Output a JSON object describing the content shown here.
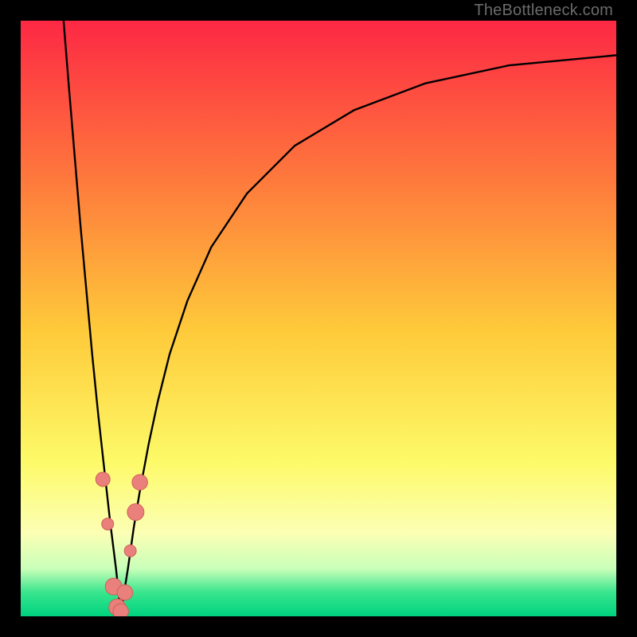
{
  "watermark": "TheBottleneck.com",
  "colors": {
    "grad_top": "#fd2844",
    "grad_mid1": "#fe7d3c",
    "grad_mid2": "#feca3a",
    "grad_mid3": "#fdfa68",
    "grad_mid4": "#fcffb4",
    "grad_bottom1": "#c9ffb9",
    "grad_bottom2": "#38e58d",
    "grad_bottom3": "#00d27f",
    "curve_stroke": "#000000",
    "marker_fill": "#e9807b",
    "marker_stroke": "#d35e59"
  },
  "chart_data": {
    "type": "line",
    "title": "",
    "xlabel": "",
    "ylabel": "",
    "xlim": [
      0,
      100
    ],
    "ylim": [
      0,
      100
    ],
    "series": [
      {
        "name": "bottleneck-curve",
        "x": [
          7.2,
          8.0,
          9.0,
          10.0,
          11.0,
          12.0,
          13.0,
          14.0,
          15.0,
          16.0,
          16.8,
          18.0,
          19.0,
          20.0,
          21.5,
          23.0,
          25.0,
          28.0,
          32.0,
          38.0,
          46.0,
          56.0,
          68.0,
          82.0,
          100.0
        ],
        "y": [
          100.0,
          90.0,
          78.0,
          66.0,
          55.0,
          44.0,
          34.0,
          25.0,
          16.0,
          8.0,
          0.5,
          8.0,
          15.0,
          21.0,
          29.0,
          36.0,
          44.0,
          53.0,
          62.0,
          71.0,
          79.0,
          85.0,
          89.5,
          92.5,
          94.2
        ]
      }
    ],
    "markers": [
      {
        "x": 13.8,
        "y": 23.0,
        "r": 1.2
      },
      {
        "x": 14.6,
        "y": 15.5,
        "r": 1.0
      },
      {
        "x": 15.6,
        "y": 5.0,
        "r": 1.4
      },
      {
        "x": 16.2,
        "y": 1.5,
        "r": 1.4
      },
      {
        "x": 16.8,
        "y": 0.8,
        "r": 1.3
      },
      {
        "x": 17.5,
        "y": 4.0,
        "r": 1.3
      },
      {
        "x": 18.4,
        "y": 11.0,
        "r": 1.0
      },
      {
        "x": 19.3,
        "y": 17.5,
        "r": 1.4
      },
      {
        "x": 20.0,
        "y": 22.5,
        "r": 1.3
      }
    ]
  }
}
